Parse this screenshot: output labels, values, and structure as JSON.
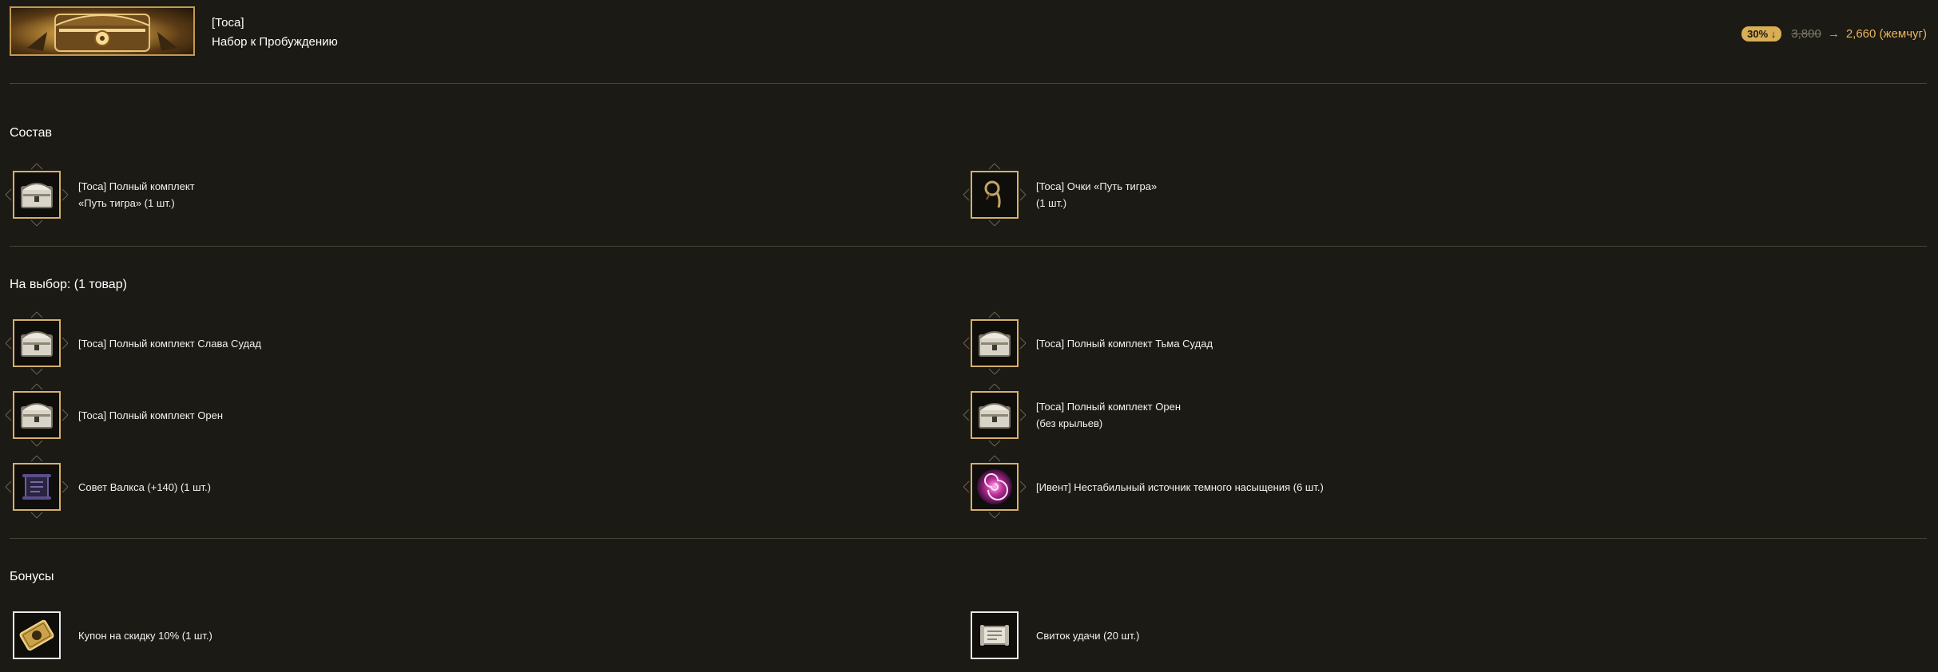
{
  "header": {
    "banner_icon": "treasure-chest",
    "category": "[Тоса]",
    "name": "Набор к Пробуждению",
    "discount": "30% ↓",
    "old_price": "3,800",
    "arrow": "→",
    "new_price": "2,660 (жемчуг)"
  },
  "composition": {
    "title": "Состав",
    "items": [
      {
        "icon": "chest-icon",
        "line1": "[Тоса] Полный комплект",
        "line2": "«Путь тигра» (1 шт.)"
      },
      {
        "icon": "glasses-icon",
        "line1": "[Тоса] Очки «Путь тигра»",
        "line2": "(1 шт.)"
      }
    ]
  },
  "choice": {
    "title": "На выбор: (1 товар)",
    "items": [
      {
        "icon": "chest-icon",
        "line1": "[Тоса] Полный комплект Слава Судад"
      },
      {
        "icon": "chest-icon",
        "line1": "[Тоса] Полный комплект Тьма Судад"
      },
      {
        "icon": "chest-icon",
        "line1": "[Тоса] Полный комплект Орен"
      },
      {
        "icon": "chest-icon",
        "line1": "[Тоса] Полный комплект Орен",
        "line2": "(без крыльев)"
      },
      {
        "icon": "scroll-icon",
        "line1": "Совет Валкса (+140) (1 шт.)"
      },
      {
        "icon": "vortex-icon",
        "line1": "[Ивент] Нестабильный источник темного насыщения (6 шт.)"
      }
    ]
  },
  "bonuses": {
    "title": "Бонусы",
    "items": [
      {
        "icon": "coupon-icon",
        "line1": "Купон на скидку 10% (1 шт.)"
      },
      {
        "icon": "luck-scroll-icon",
        "line1": "Свиток удачи (20 шт.)"
      }
    ]
  },
  "colors": {
    "background": "#1b1a14",
    "accent_gold": "#d9ae55",
    "price": "#e9b35e",
    "divider": "#4a4638"
  }
}
